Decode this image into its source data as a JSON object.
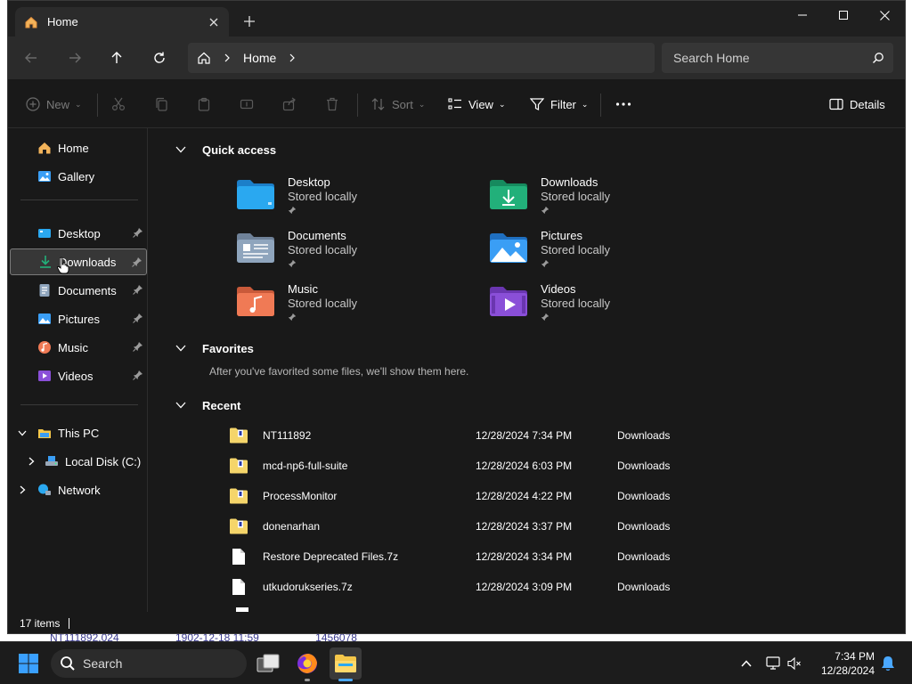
{
  "background_window": {
    "row_texts": [
      "NT111892.024",
      "1902-12-18 11:59",
      "1456078"
    ]
  },
  "window": {
    "tab_title": "Home",
    "address": {
      "crumb": "Home"
    },
    "search": {
      "placeholder": "Search Home"
    }
  },
  "commandbar": {
    "new_label": "New",
    "sort_label": "Sort",
    "view_label": "View",
    "filter_label": "Filter",
    "details_label": "Details"
  },
  "sidebar": {
    "top": [
      {
        "label": "Home",
        "icon": "home-icon"
      },
      {
        "label": "Gallery",
        "icon": "gallery-icon"
      }
    ],
    "pinned": [
      {
        "label": "Desktop",
        "icon": "desktop-icon"
      },
      {
        "label": "Downloads",
        "icon": "downloads-icon",
        "selected": true
      },
      {
        "label": "Documents",
        "icon": "documents-icon"
      },
      {
        "label": "Pictures",
        "icon": "pictures-icon"
      },
      {
        "label": "Music",
        "icon": "music-icon"
      },
      {
        "label": "Videos",
        "icon": "videos-icon"
      }
    ],
    "tree": [
      {
        "label": "This PC",
        "icon": "this-pc-icon",
        "expanded": true
      },
      {
        "label": "Local Disk (C:)",
        "icon": "drive-icon"
      },
      {
        "label": "Network",
        "icon": "network-icon"
      }
    ]
  },
  "content": {
    "quick_access_title": "Quick access",
    "quick_access": [
      {
        "name": "Desktop",
        "sub": "Stored locally",
        "color": "#2aa8f0"
      },
      {
        "name": "Downloads",
        "sub": "Stored locally",
        "color": "#22b07a"
      },
      {
        "name": "Documents",
        "sub": "Stored locally",
        "color": "#8fa5bd"
      },
      {
        "name": "Pictures",
        "sub": "Stored locally",
        "color": "#3a9ef5"
      },
      {
        "name": "Music",
        "sub": "Stored locally",
        "color": "#f07a55"
      },
      {
        "name": "Videos",
        "sub": "Stored locally",
        "color": "#8a4fd8"
      }
    ],
    "favorites_title": "Favorites",
    "favorites_empty": "After you've favorited some files, we'll show them here.",
    "recent_title": "Recent",
    "recent": [
      {
        "name": "NT111892",
        "date": "12/28/2024 7:34 PM",
        "location": "Downloads",
        "type": "zip"
      },
      {
        "name": "mcd-np6-full-suite",
        "date": "12/28/2024 6:03 PM",
        "location": "Downloads",
        "type": "zip"
      },
      {
        "name": "ProcessMonitor",
        "date": "12/28/2024 4:22 PM",
        "location": "Downloads",
        "type": "zip"
      },
      {
        "name": "donenarhan",
        "date": "12/28/2024 3:37 PM",
        "location": "Downloads",
        "type": "zip"
      },
      {
        "name": "Restore Deprecated Files.7z",
        "date": "12/28/2024 3:34 PM",
        "location": "Downloads",
        "type": "file"
      },
      {
        "name": "utkudorukseries.7z",
        "date": "12/28/2024 3:09 PM",
        "location": "Downloads",
        "type": "file"
      }
    ]
  },
  "statusbar": {
    "items": "17 items"
  },
  "taskbar": {
    "search_placeholder": "Search",
    "time": "7:34 PM",
    "date": "12/28/2024"
  }
}
